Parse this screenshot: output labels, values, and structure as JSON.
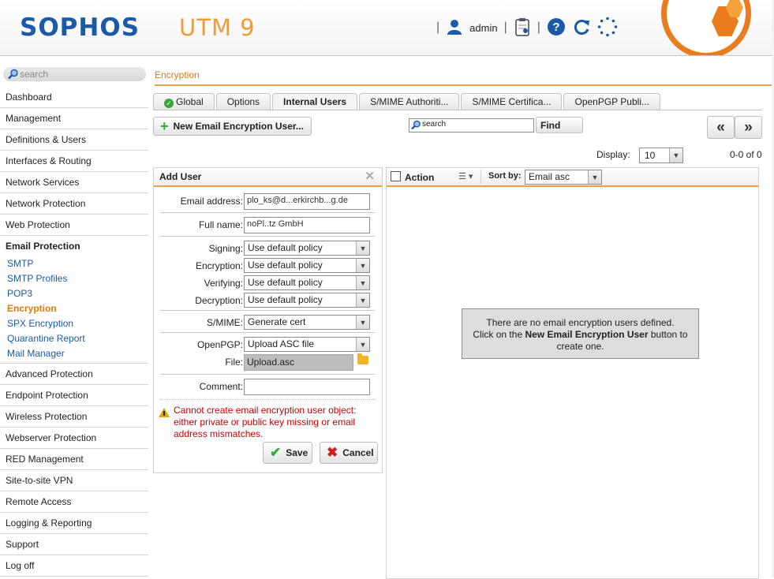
{
  "header": {
    "brand": "SOPHOS",
    "product": "UTM 9",
    "user": "admin",
    "separators": [
      "|",
      "|",
      "|"
    ]
  },
  "sidebar": {
    "search_placeholder": "search",
    "items": [
      {
        "label": "Dashboard"
      },
      {
        "label": "Management"
      },
      {
        "label": "Definitions & Users"
      },
      {
        "label": "Interfaces & Routing"
      },
      {
        "label": "Network Services"
      },
      {
        "label": "Network Protection"
      },
      {
        "label": "Web Protection"
      }
    ],
    "group": {
      "title": "Email Protection",
      "subitems": [
        {
          "label": "SMTP"
        },
        {
          "label": "SMTP Profiles"
        },
        {
          "label": "POP3"
        },
        {
          "label": "Encryption"
        },
        {
          "label": "SPX Encryption"
        },
        {
          "label": "Quarantine Report"
        },
        {
          "label": "Mail Manager"
        }
      ]
    },
    "items_after": [
      {
        "label": "Advanced Protection"
      },
      {
        "label": "Endpoint Protection"
      },
      {
        "label": "Wireless Protection"
      },
      {
        "label": "Webserver Protection"
      },
      {
        "label": "RED Management"
      },
      {
        "label": "Site-to-site VPN"
      },
      {
        "label": "Remote Access"
      },
      {
        "label": "Logging & Reporting"
      },
      {
        "label": "Support"
      },
      {
        "label": "Log off"
      }
    ]
  },
  "main": {
    "breadcrumb": "Encryption",
    "tabs": [
      {
        "label": "Global"
      },
      {
        "label": "Options"
      },
      {
        "label": "Internal Users"
      },
      {
        "label": "S/MIME Authoriti..."
      },
      {
        "label": "S/MIME Certifica..."
      },
      {
        "label": "OpenPGP Publi..."
      }
    ],
    "new_button": "New Email Encryption User...",
    "search_placeholder": "search",
    "find_button": "Find",
    "prev_glyph": "«",
    "next_glyph": "»",
    "display_label": "Display:",
    "display_value": "10",
    "counter": "0-0 of 0"
  },
  "add_user": {
    "title": "Add User",
    "close_glyph": "✕",
    "email_label": "Email address:",
    "email_value": "plo_ks@d...erkirchb...g.de",
    "fullname_label": "Full name:",
    "fullname_value": "noPl..tz GmbH",
    "signing_label": "Signing:",
    "signing_value": "Use default policy",
    "encryption_label": "Encryption:",
    "encryption_value": "Use default policy",
    "verifying_label": "Verifying:",
    "verifying_value": "Use default policy",
    "decryption_label": "Decryption:",
    "decryption_value": "Use default policy",
    "smime_label": "S/MIME:",
    "smime_value": "Generate cert",
    "openpgp_label": "OpenPGP:",
    "openpgp_value": "Upload ASC file",
    "file_label": "File:",
    "file_value": "Upload.asc",
    "comment_label": "Comment:",
    "comment_value": "",
    "error": "Cannot create email encryption user object: either private or public key missing or email address mismatches.",
    "save": "Save",
    "cancel": "Cancel"
  },
  "list": {
    "action_label": "Action",
    "sortby_label": "Sort by:",
    "sort_value": "Email asc",
    "empty_line1": "There are no email encryption users defined.",
    "empty_line2_pre": "Click on the",
    "empty_line2_bold": "New Email Encryption User",
    "empty_line2_post": "button to",
    "empty_line3": "create one."
  },
  "colors": {
    "accent": "#e07a10",
    "brand_blue": "#1a5aa8",
    "error": "#cc0000",
    "ok_green": "#3ba63b"
  }
}
